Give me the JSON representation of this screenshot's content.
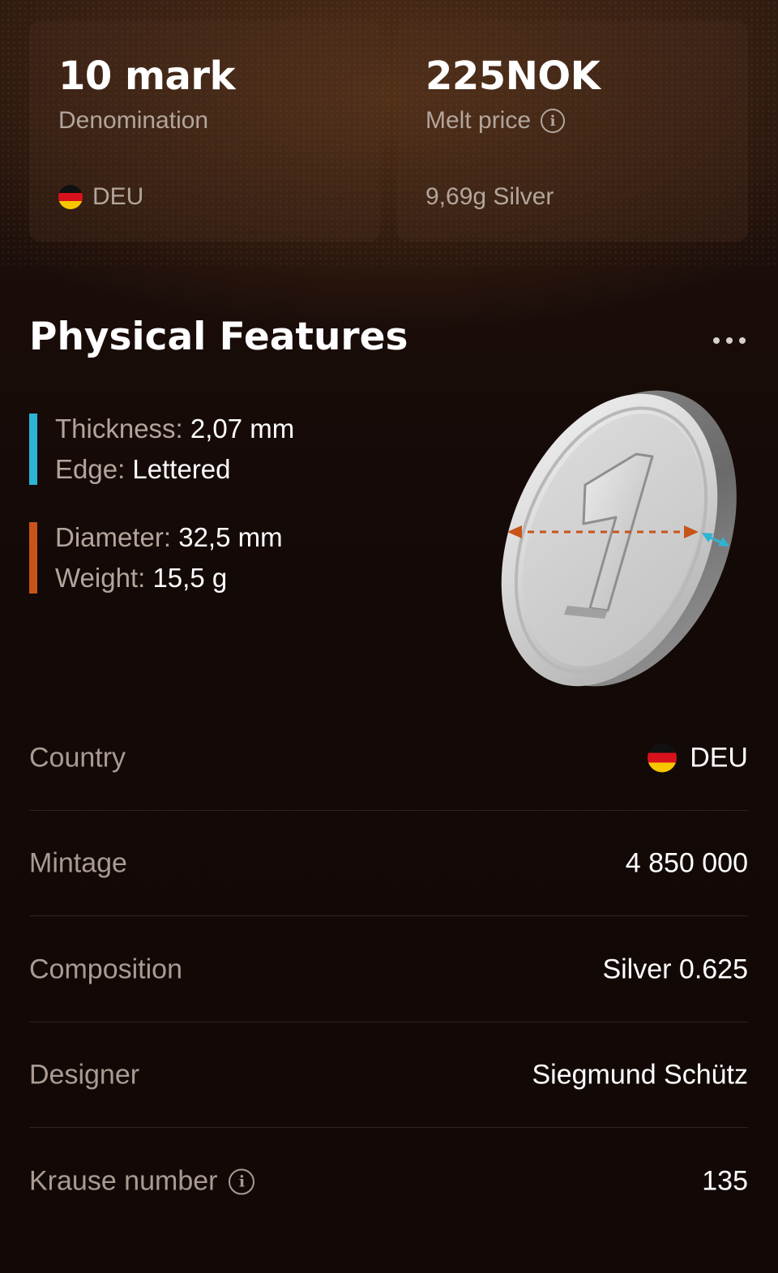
{
  "cards": {
    "denomination": {
      "value": "10 mark",
      "label": "Denomination",
      "country": "DEU"
    },
    "melt": {
      "value": "225NOK",
      "label": "Melt price",
      "sub": "9,69g Silver"
    }
  },
  "physical": {
    "title": "Physical Features",
    "group1": {
      "color": "#2fb3d4",
      "thickness_label": "Thickness:",
      "thickness_value": "2,07 mm",
      "edge_label": "Edge:",
      "edge_value": "Lettered"
    },
    "group2": {
      "color": "#c8541a",
      "diameter_label": "Diameter:",
      "diameter_value": "32,5 mm",
      "weight_label": "Weight:",
      "weight_value": "15,5 g"
    },
    "coin_numeral": "1"
  },
  "details": [
    {
      "label": "Country",
      "value": "DEU",
      "flag": true
    },
    {
      "label": "Mintage",
      "value": "4 850 000"
    },
    {
      "label": "Composition",
      "value": "Silver 0.625"
    },
    {
      "label": "Designer",
      "value": "Siegmund Schütz"
    },
    {
      "label": "Krause number",
      "value": "135",
      "info": true
    }
  ]
}
